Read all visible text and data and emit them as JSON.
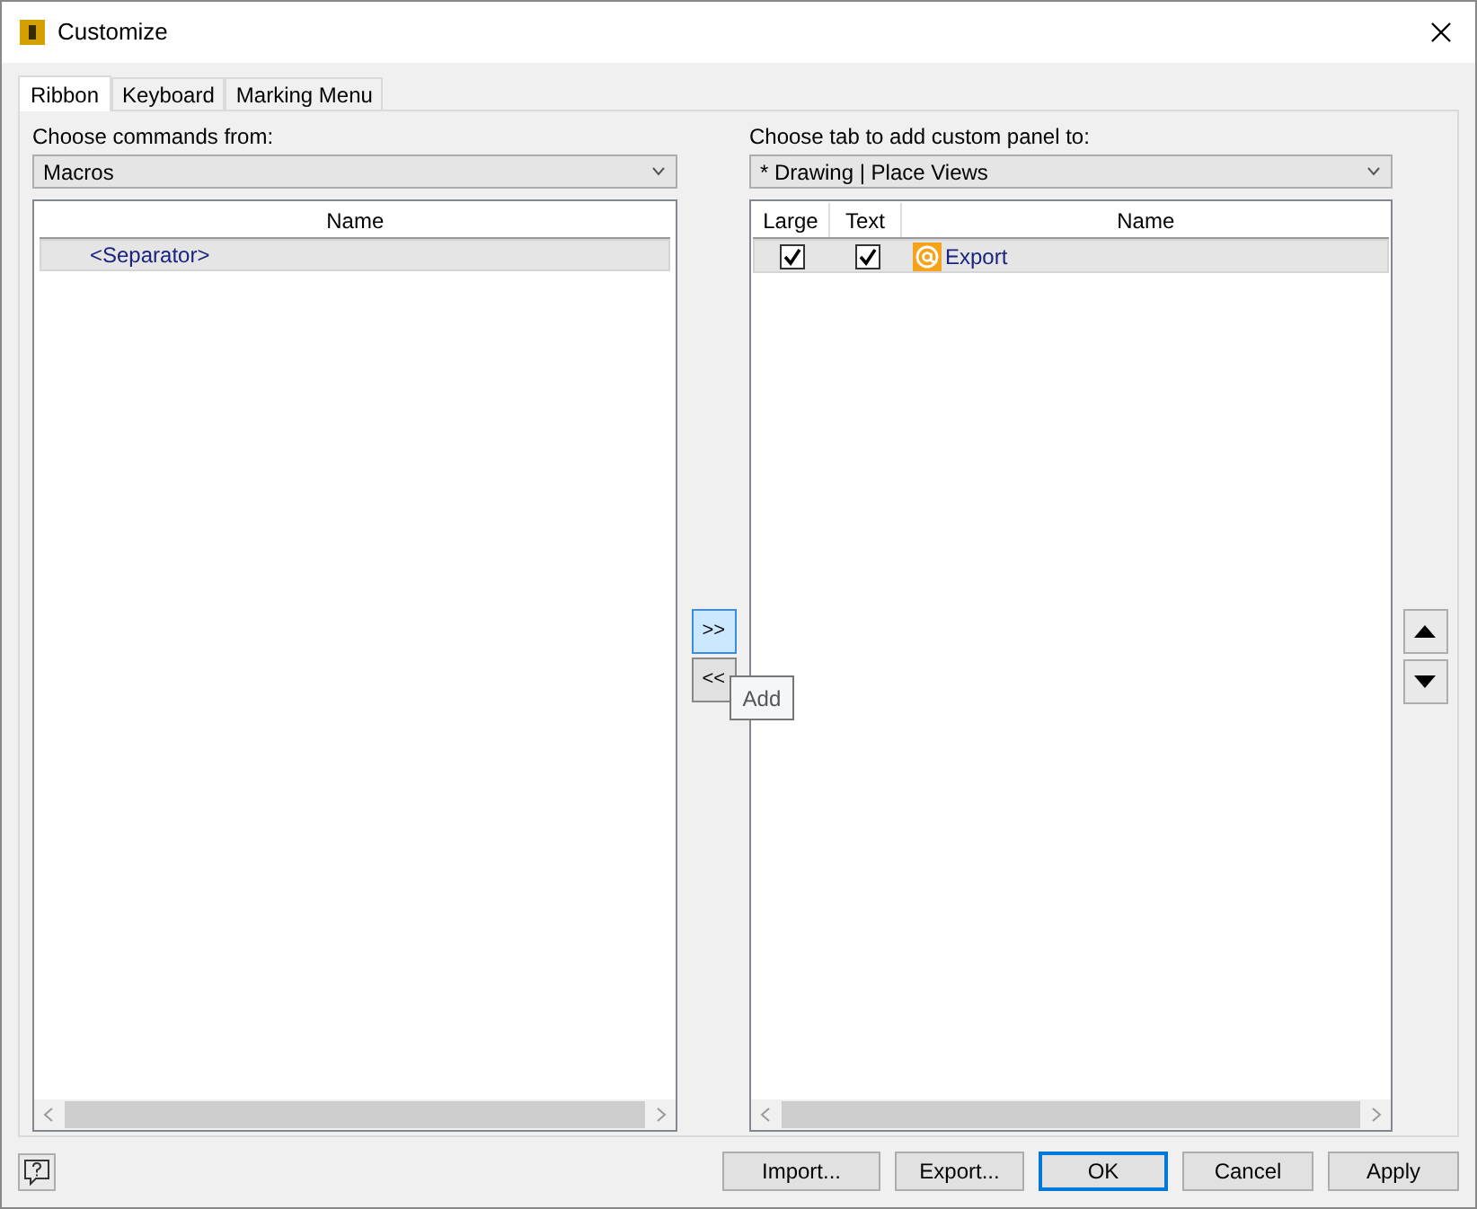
{
  "window": {
    "title": "Customize"
  },
  "tabs": [
    {
      "label": "Ribbon",
      "selected": true
    },
    {
      "label": "Keyboard",
      "selected": false
    },
    {
      "label": "Marking Menu",
      "selected": false
    }
  ],
  "left": {
    "label": "Choose commands from:",
    "dropdown": "Macros",
    "columns": [
      "Name"
    ],
    "rows": [
      {
        "name": "<Separator>",
        "selected": true
      }
    ]
  },
  "transfer_buttons": [
    {
      "label": ">>",
      "hovered": true
    },
    {
      "label": "<<",
      "hovered": false
    }
  ],
  "tooltip": "Add",
  "right": {
    "label": "Choose tab to add custom panel to:",
    "dropdown": "* Drawing | Place Views",
    "columns": [
      "Large",
      "Text",
      "Name"
    ],
    "rows": [
      {
        "large": true,
        "text": true,
        "name": "Export",
        "selected": true
      }
    ]
  },
  "buttons": [
    {
      "label": "Import...",
      "default": false
    },
    {
      "label": "Export...",
      "default": false
    },
    {
      "label": "OK",
      "default": true
    },
    {
      "label": "Cancel",
      "default": false
    },
    {
      "label": "Apply",
      "default": false
    }
  ]
}
